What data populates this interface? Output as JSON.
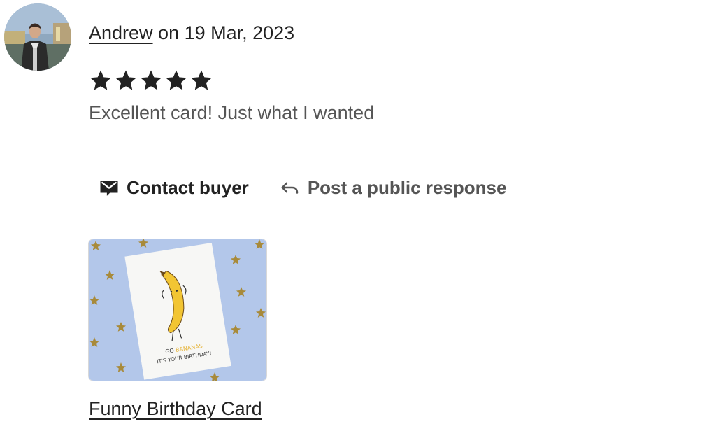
{
  "review": {
    "reviewer_name": "Andrew",
    "date_text": " on 19 Mar, 2023",
    "rating": 5,
    "rating_max": 5,
    "text": "Excellent card! Just what I wanted",
    "avatar_icon": "user-avatar-photo"
  },
  "actions": {
    "contact_label": "Contact buyer",
    "contact_icon": "envelope-icon",
    "respond_label": "Post a public response",
    "respond_icon": "reply-arrow-icon"
  },
  "listing": {
    "title": "Funny Birthday Card",
    "card_line1_go": "GO",
    "card_line1_bananas": "BANANAS",
    "card_line2": "IT'S YOUR BIRTHDAY!"
  },
  "colors": {
    "text": "#222222",
    "muted": "#555555",
    "star": "#222222",
    "thumb_bg": "#b3c7ea"
  }
}
